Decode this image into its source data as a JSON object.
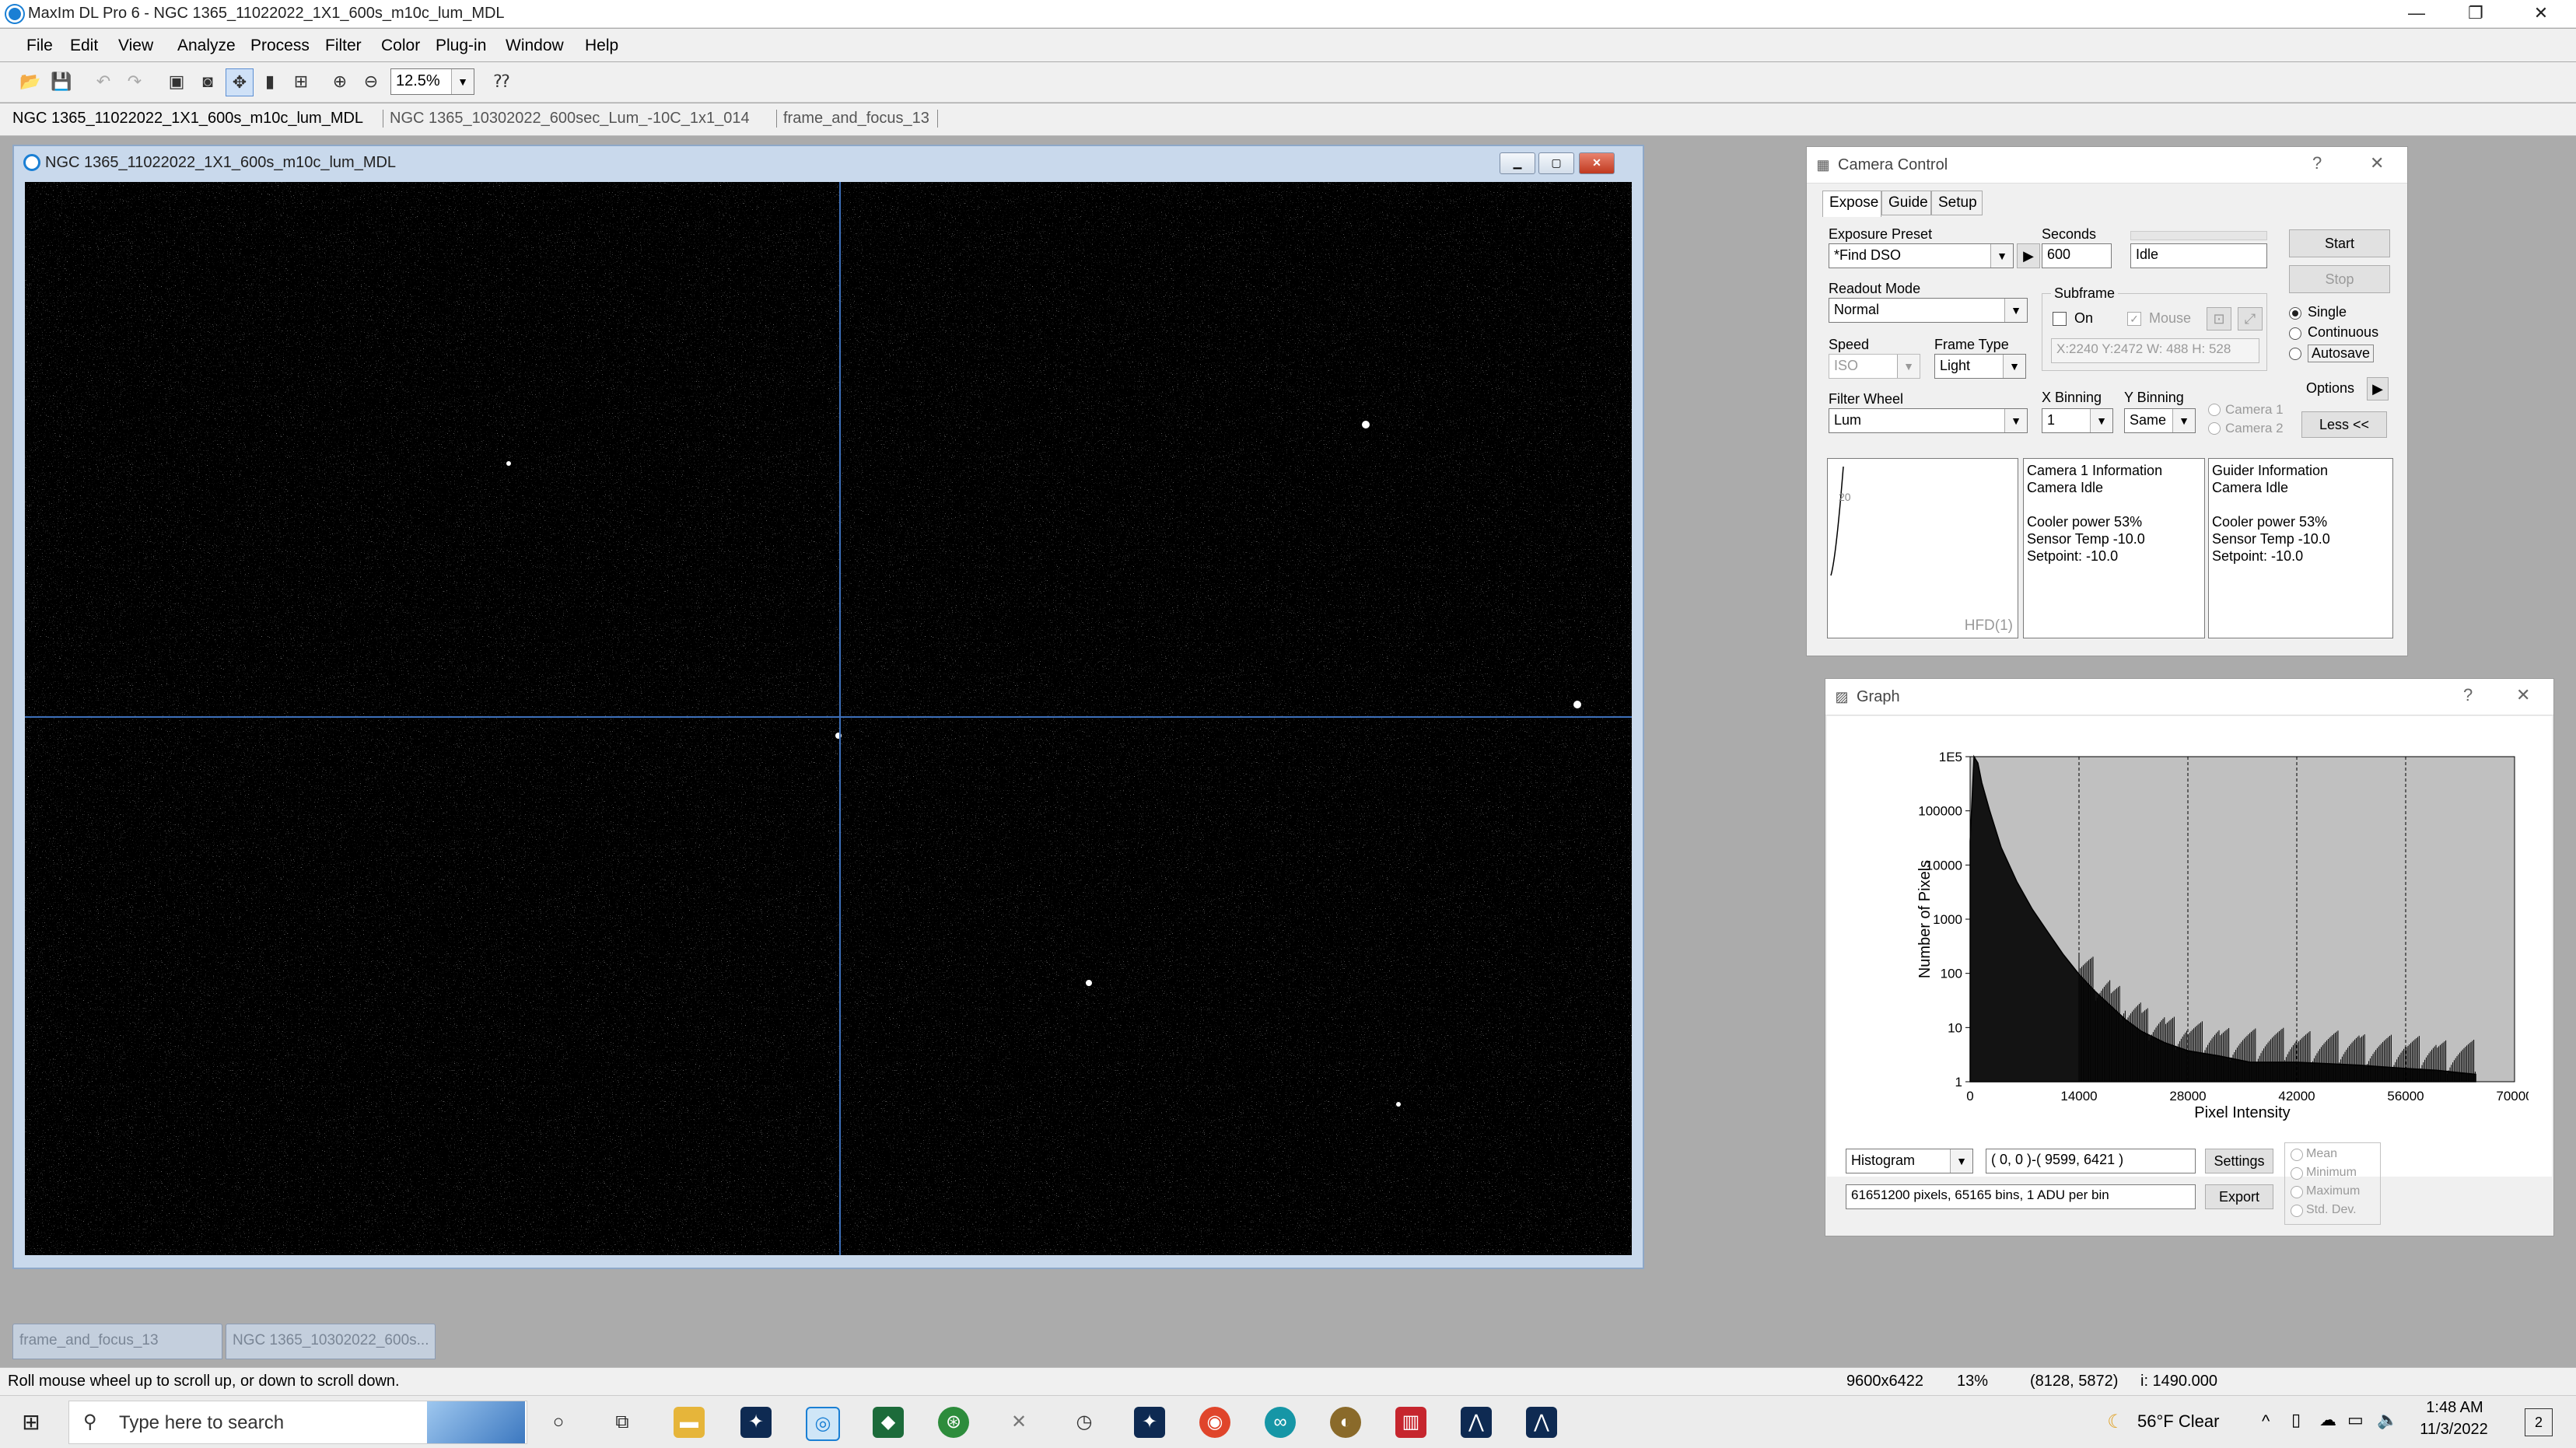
{
  "window": {
    "title": "MaxIm DL Pro 6 - NGC 1365_11022022_1X1_600s_m10c_lum_MDL",
    "controls": [
      "—",
      "❐",
      "✕"
    ]
  },
  "menu": [
    "File",
    "Edit",
    "View",
    "Analyze",
    "Process",
    "Filter",
    "Color",
    "Plug-in",
    "Window",
    "Help"
  ],
  "toolbar": {
    "zoom": "12.5%"
  },
  "image_tabs": [
    "NGC 1365_11022022_1X1_600s_m10c_lum_MDL",
    "NGC 1365_10302022_600sec_Lum_-10C_1x1_014",
    "frame_and_focus_13"
  ],
  "image_window": {
    "title": "NGC 1365_11022022_1X1_600s_m10c_lum_MDL"
  },
  "minimized": [
    "frame_and_focus_13",
    "NGC 1365_10302022_600s..."
  ],
  "statusbar": {
    "hint": "Roll mouse wheel up to scroll up, or down to scroll down.",
    "dims": "9600x6422",
    "zoom": "13%",
    "coords": "(8128, 5872)",
    "intensity": "i: 1490.000"
  },
  "taskbar": {
    "search": "Type here to search",
    "weather": "56°F  Clear",
    "time": "1:48 AM",
    "date": "11/3/2022",
    "notif": "2"
  },
  "camera": {
    "title": "Camera Control",
    "help": "?",
    "close": "✕",
    "tabs": [
      "Expose",
      "Guide",
      "Setup"
    ],
    "exposure_preset_label": "Exposure Preset",
    "exposure_preset": "*Find DSO",
    "seconds_label": "Seconds",
    "seconds": "600",
    "status": "Idle",
    "readout_label": "Readout Mode",
    "readout": "Normal",
    "subframe_label": "Subframe",
    "on_label": "On",
    "mouse_label": "Mouse",
    "subframe_coords": "X:2240 Y:2472 W: 488 H: 528",
    "speed_label": "Speed",
    "speed": "ISO",
    "frame_type_label": "Frame Type",
    "frame_type": "Light",
    "filter_label": "Filter Wheel",
    "filter": "Lum",
    "xbin_label": "X Binning",
    "xbin": "1",
    "ybin_label": "Y Binning",
    "ybin": "Same",
    "camera1": "Camera 1",
    "camera2": "Camera 2",
    "start": "Start",
    "stop": "Stop",
    "single": "Single",
    "continuous": "Continuous",
    "autosave": "Autosave",
    "options": "Options",
    "less": "Less <<",
    "hfd_label": "HFD(1)",
    "hfd_small": "20",
    "cam_info": [
      "Camera 1 Information",
      "Camera Idle",
      "",
      "Cooler power 53%",
      "Sensor Temp -10.0",
      "Setpoint: -10.0"
    ],
    "guider_info": [
      "Guider Information",
      "Camera Idle",
      "",
      "Cooler power 53%",
      "Sensor Temp -10.0",
      "Setpoint: -10.0"
    ]
  },
  "graph": {
    "title": "Graph",
    "help": "?",
    "close": "✕",
    "mode": "Histogram",
    "range": "( 0, 0 )-( 9599, 6421 )",
    "info": "61651200 pixels, 65165 bins, 1 ADU per bin",
    "settings": "Settings",
    "export": "Export",
    "stats": [
      "Mean",
      "Minimum",
      "Maximum",
      "Std. Dev."
    ]
  },
  "chart_data": {
    "type": "area",
    "title": "",
    "xlabel": "Pixel Intensity",
    "ylabel": "Number of Pixels",
    "xlim": [
      0,
      70000
    ],
    "ylim": [
      1,
      100000
    ],
    "yscale": "log",
    "x_ticks": [
      "0",
      "14000",
      "28000",
      "42000",
      "56000",
      "70000"
    ],
    "y_ticks": [
      "1E5",
      "100000",
      "10000",
      "1000",
      "100",
      "10",
      "1"
    ],
    "grid": true,
    "series": [
      {
        "x": [
          0,
          500,
          1000,
          1500,
          2500,
          4000,
          6000,
          8000,
          10000,
          12000,
          14000,
          16000,
          18000,
          20000,
          22000,
          25000,
          28000,
          32000,
          36000,
          42000,
          50000,
          56000,
          60000,
          65000
        ],
        "values": [
          5000,
          150000,
          80000,
          40000,
          15000,
          4000,
          1200,
          450,
          200,
          90,
          45,
          25,
          15,
          9,
          6,
          4,
          3,
          2.5,
          2,
          2,
          1.8,
          1.6,
          1.5,
          1.3
        ]
      }
    ]
  },
  "colors": {
    "crosshair": "#3d6fb8",
    "plot_bg": "#c0c0c0",
    "accent": "#1a7fd4"
  }
}
